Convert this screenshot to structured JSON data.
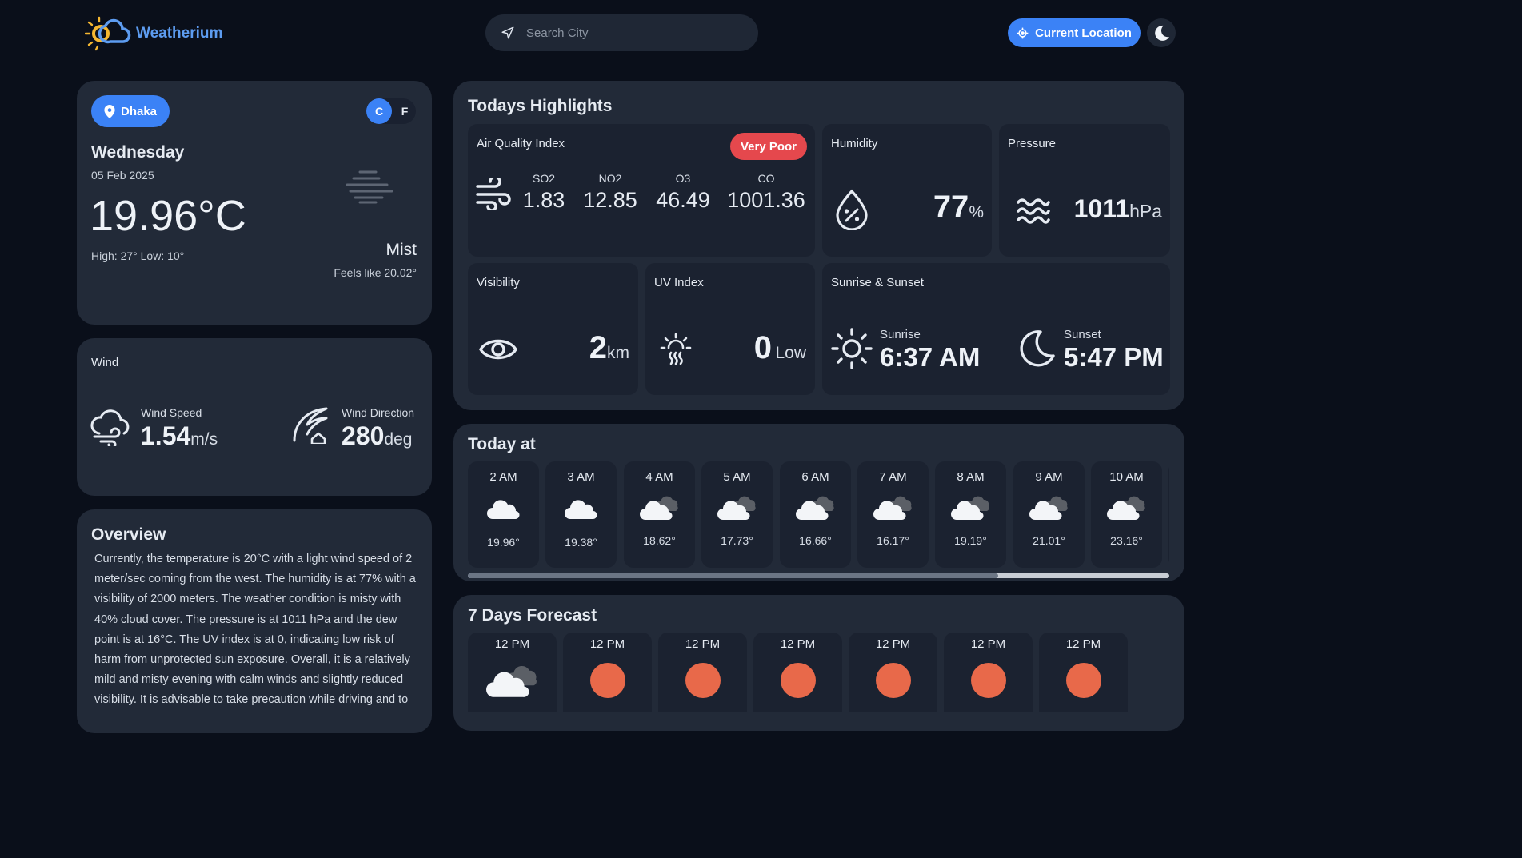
{
  "header": {
    "brand": "Weatherium",
    "search_placeholder": "Search City",
    "location_button": "Current Location"
  },
  "current": {
    "city": "Dhaka",
    "unit_c": "C",
    "unit_f": "F",
    "day": "Wednesday",
    "date": "05 Feb 2025",
    "temperature": "19.96°C",
    "high_low": "High: 27° Low: 10°",
    "condition": "Mist",
    "feels_like": "Feels like 20.02°"
  },
  "wind": {
    "title": "Wind",
    "speed_label": "Wind Speed",
    "speed_value": "1.54",
    "speed_unit": "m/s",
    "direction_label": "Wind Direction",
    "direction_value": "280",
    "direction_unit": "deg"
  },
  "overview": {
    "title": "Overview",
    "text": "Currently, the temperature is 20°C with a light wind speed of 2 meter/sec coming from the west. The humidity is at 77% with a visibility of 2000 meters. The weather condition is misty with 40% cloud cover. The pressure is at 1011 hPa and the dew point is at 16°C. The UV index is at 0, indicating low risk of harm from unprotected sun exposure. Overall, it is a relatively mild and misty evening with calm winds and slightly reduced visibility. It is advisable to take precaution while driving and to"
  },
  "highlights": {
    "title": "Todays Highlights",
    "aqi": {
      "label": "Air Quality Index",
      "badge": "Very Poor",
      "badge_color": "#e5484d",
      "items": [
        {
          "name": "SO2",
          "value": "1.83"
        },
        {
          "name": "NO2",
          "value": "12.85"
        },
        {
          "name": "O3",
          "value": "46.49"
        },
        {
          "name": "CO",
          "value": "1001.36"
        }
      ]
    },
    "humidity": {
      "label": "Humidity",
      "value": "77",
      "unit": "%"
    },
    "pressure": {
      "label": "Pressure",
      "value": "1011",
      "unit": "hPa"
    },
    "visibility": {
      "label": "Visibility",
      "value": "2",
      "unit": "km"
    },
    "uv": {
      "label": "UV Index",
      "value": "0",
      "unit": "Low"
    },
    "sun": {
      "label": "Sunrise & Sunset",
      "sunrise_label": "Sunrise",
      "sunrise": "6:37 AM",
      "sunset_label": "Sunset",
      "sunset": "5:47 PM"
    }
  },
  "today": {
    "title": "Today at",
    "hours": [
      {
        "time": "2 AM",
        "temp": "19.96°",
        "icon": "cloud-icon"
      },
      {
        "time": "3 AM",
        "temp": "19.38°",
        "icon": "cloud-icon"
      },
      {
        "time": "4 AM",
        "temp": "18.62°",
        "icon": "overcast-clouds-icon"
      },
      {
        "time": "5 AM",
        "temp": "17.73°",
        "icon": "overcast-clouds-icon"
      },
      {
        "time": "6 AM",
        "temp": "16.66°",
        "icon": "overcast-clouds-icon"
      },
      {
        "time": "7 AM",
        "temp": "16.17°",
        "icon": "overcast-clouds-icon"
      },
      {
        "time": "8 AM",
        "temp": "19.19°",
        "icon": "overcast-clouds-icon"
      },
      {
        "time": "9 AM",
        "temp": "21.01°",
        "icon": "overcast-clouds-icon"
      },
      {
        "time": "10 AM",
        "temp": "23.16°",
        "icon": "overcast-clouds-icon"
      }
    ]
  },
  "forecast": {
    "title": "7 Days Forecast",
    "days": [
      {
        "time": "12 PM",
        "icon": "overcast-clouds-icon"
      },
      {
        "time": "12 PM",
        "icon": "sun-icon"
      },
      {
        "time": "12 PM",
        "icon": "sun-icon"
      },
      {
        "time": "12 PM",
        "icon": "sun-icon"
      },
      {
        "time": "12 PM",
        "icon": "sun-icon"
      },
      {
        "time": "12 PM",
        "icon": "sun-icon"
      },
      {
        "time": "12 PM",
        "icon": "sun-icon"
      }
    ]
  },
  "colors": {
    "accent": "#3b82f6",
    "background": "#0a0f1a",
    "card": "#222a38",
    "tile": "#1b2230",
    "sun_orange": "#e8694a"
  }
}
